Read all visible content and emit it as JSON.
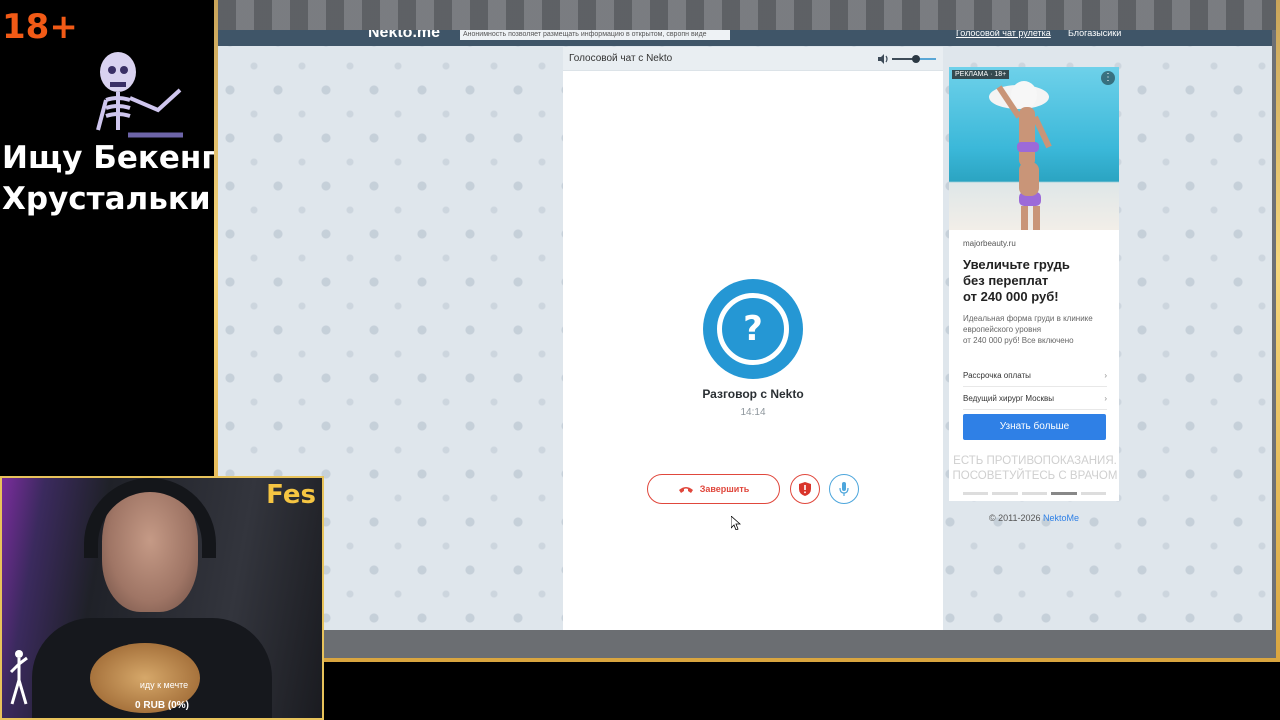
{
  "overlay": {
    "age_badge": "18+",
    "stream_title_line1": "Ищу Бекенг",
    "stream_title_line2": "Хрустальки",
    "webcam_name": "Fes",
    "webcam_caption": "иду к мечте",
    "donation_goal": "0 RUB (0%)"
  },
  "site": {
    "logo": "Nekto.me",
    "notice": "Анонимность позволяет размещать информацию в открытом, свропн виде",
    "nav_voice": "Голосовой чат рулетка",
    "nav_login": "Блогазысики"
  },
  "chat": {
    "header_title": "Голосовой чат с Nekto",
    "avatar_symbol": "?",
    "partner_name": "Разговор с Nekto",
    "timer": "14:14",
    "end_call_label": "Завершить",
    "volume_level": 0.55
  },
  "ad": {
    "badge": "РЕКЛАМА · 18+",
    "domain": "majorbeauty.ru",
    "headline": "Увеличьте грудь\nбез переплат\nот 240 000 руб!",
    "description": "Идеальная форма груди в клинике\nевропейского уровня\nот 240 000 руб! Все включено",
    "links": [
      "Рассрочка оплаты",
      "Ведущий хирург Москвы"
    ],
    "cta": "Узнать больше",
    "warning": "ЕСТЬ ПРОТИВОПОКАЗАНИЯ.\nПОСОВЕТУЙТЕСЬ С ВРАЧОМ"
  },
  "footer": {
    "copyright_prefix": "© 2011-2026 ",
    "copyright_link": "NektoMe"
  },
  "colors": {
    "accent_blue": "#2597d4",
    "end_call_red": "#e0473c",
    "frame_gold": "#f7d77c",
    "age_badge": "#f25a16"
  }
}
